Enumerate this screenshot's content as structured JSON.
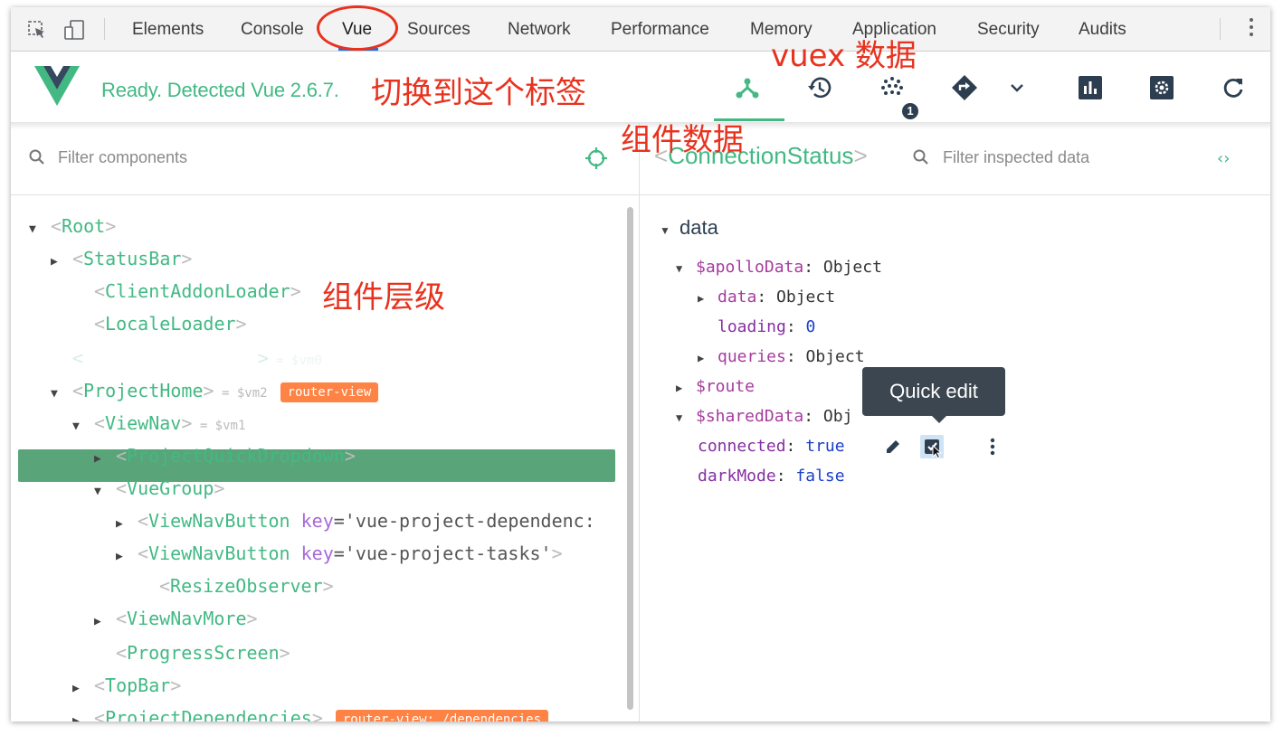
{
  "devtools": {
    "tabs": [
      "Elements",
      "Console",
      "Vue",
      "Sources",
      "Network",
      "Performance",
      "Memory",
      "Application",
      "Security",
      "Audits"
    ],
    "active_tab": "Vue"
  },
  "vue_header": {
    "status": "Ready. Detected Vue 2.6.7.",
    "vuex_badge": "1",
    "icons": [
      "components-icon",
      "history-icon",
      "vuex-icon",
      "router-icon",
      "chevron-down-icon",
      "performance-icon",
      "settings-icon",
      "refresh-icon"
    ]
  },
  "left_pane": {
    "filter_placeholder": "Filter components",
    "tree": [
      {
        "arrow": "▼",
        "name": "Root"
      },
      {
        "arrow": "▶",
        "name": "StatusBar"
      },
      {
        "arrow": "",
        "name": "ClientAddonLoader"
      },
      {
        "arrow": "",
        "name": "LocaleLoader"
      },
      {
        "arrow": "▶",
        "name": "ConnectionStatus",
        "vm": "= $vm0",
        "selected": true
      },
      {
        "arrow": "▼",
        "name": "ProjectHome",
        "vm": "= $vm2",
        "badge": "router-view"
      },
      {
        "arrow": "▼",
        "name": "ViewNav",
        "vm": "= $vm1"
      },
      {
        "arrow": "▶",
        "name": "ProjectQuickDropdown"
      },
      {
        "arrow": "▼",
        "name": "VueGroup"
      },
      {
        "arrow": "▶",
        "name": "ViewNavButton",
        "attr_key": "key",
        "attr_value": "='vue-project-dependenc:"
      },
      {
        "arrow": "▶",
        "name": "ViewNavButton",
        "attr_key": "key",
        "attr_value": "='vue-project-tasks'"
      },
      {
        "arrow": "",
        "name": "ResizeObserver"
      },
      {
        "arrow": "▶",
        "name": "ViewNavMore"
      },
      {
        "arrow": "",
        "name": "ProgressScreen"
      },
      {
        "arrow": "▶",
        "name": "TopBar"
      },
      {
        "arrow": "▶",
        "name": "ProjectDependencies",
        "badge": "router-view: /dependencies"
      }
    ]
  },
  "right_pane": {
    "selected_component": "ConnectionStatus",
    "filter_placeholder": "Filter inspected data",
    "section": "data",
    "rows": [
      {
        "arrow": "▼",
        "key": "$apolloData",
        "value": "Object"
      },
      {
        "arrow": "▶",
        "key": "data",
        "value": "Object"
      },
      {
        "arrow": "",
        "key": "loading",
        "value": "0"
      },
      {
        "arrow": "▶",
        "key": "queries",
        "value": "Object"
      },
      {
        "arrow": "▶",
        "key": "$route",
        "value": ""
      },
      {
        "arrow": "▼",
        "key": "$sharedData",
        "value": "Obj"
      },
      {
        "arrow": "",
        "key": "connected",
        "value": "true"
      },
      {
        "arrow": "",
        "key": "darkMode",
        "value": "false"
      }
    ],
    "tooltip": "Quick edit"
  },
  "annotations": {
    "switch_tab": "切换到这个标签",
    "vuex_data": "vuex 数据",
    "component_data": "组件数据",
    "component_hierarchy": "组件层级"
  },
  "colors": {
    "vue_green": "#42b983",
    "annotation_red": "#e8321e",
    "badge_orange": "#ff8344",
    "tooltip_bg": "#3c4650"
  }
}
